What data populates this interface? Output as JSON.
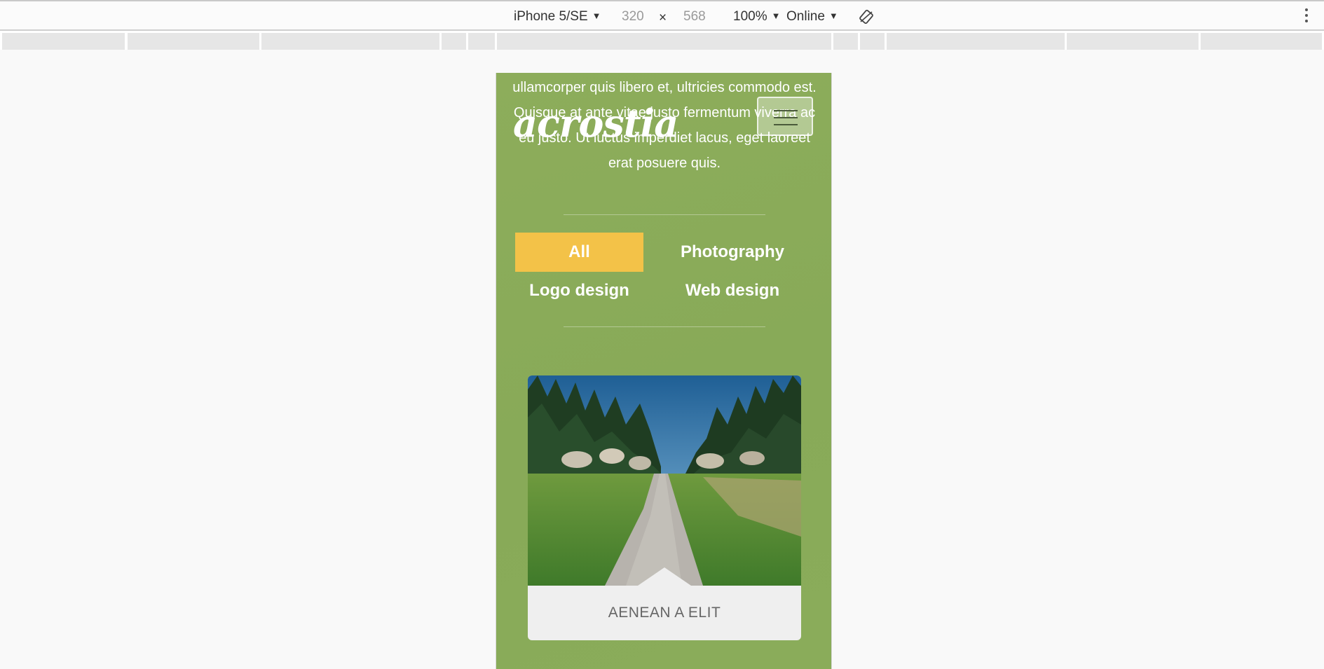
{
  "devtools": {
    "device": "iPhone 5/SE",
    "width": "320",
    "times": "×",
    "height": "568",
    "zoom": "100%",
    "network": "Online",
    "caret": "▼"
  },
  "site": {
    "logo": "acrostia",
    "intro": "ullamcorper quis libero et, ultricies commodo est. Quisque at ante vitae justo fermentum viverra ac eu justo. Ut luctus imperdiet lacus, eget laoreet erat posuere quis.",
    "filters": [
      {
        "label": "All",
        "active": true
      },
      {
        "label": "Photography",
        "active": false
      },
      {
        "label": "Logo design",
        "active": false
      },
      {
        "label": "Web design",
        "active": false
      }
    ],
    "portfolio_item": {
      "title": "AENEAN A ELIT"
    }
  },
  "colors": {
    "page_bg": "#8aac5a",
    "active_filter": "#f3c248",
    "card_bg": "#efefef"
  }
}
